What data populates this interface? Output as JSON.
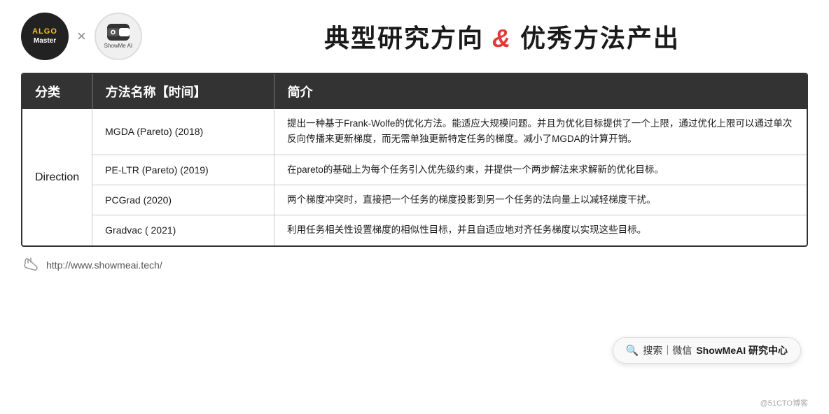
{
  "header": {
    "algo_label": "ALGO",
    "master_label": "Master",
    "cross": "×",
    "showme_label": "ShowMe AI",
    "title": "典型研究方向 & 优秀方法产出"
  },
  "table": {
    "headers": [
      "分类",
      "方法名称【时间】",
      "简介"
    ],
    "rows": [
      {
        "category": "",
        "method": "MGDA (Pareto)  (2018)",
        "desc": "提出一种基于Frank-Wolfe的优化方法。能适应大规模问题。并且为优化目标提供了一个上限，通过优化上限可以通过单次反向传播来更新梯度，而无需单独更新特定任务的梯度。减小了MGDA的计算开销。"
      },
      {
        "category": "Direction",
        "method": "PE-LTR (Pareto) (2019)",
        "desc": "在pareto的基础上为每个任务引入优先级约束，并提供一个两步解法来求解新的优化目标。"
      },
      {
        "category": "",
        "method": "PCGrad  (2020)",
        "desc": "两个梯度冲突时，直接把一个任务的梯度投影到另一个任务的法向量上以减轻梯度干扰。"
      },
      {
        "category": "",
        "method": "Gradvac  ( 2021)",
        "desc": "利用任务相关性设置梯度的相似性目标，并且自适应地对齐任务梯度以实现这些目标。"
      }
    ]
  },
  "footer": {
    "url": "http://www.showmeai.tech/"
  },
  "wechat_search": {
    "icon": "🔍",
    "separator": "搜索｜微信",
    "brand": "ShowMeAI 研究中心"
  },
  "watermark": "@51CTO博客"
}
